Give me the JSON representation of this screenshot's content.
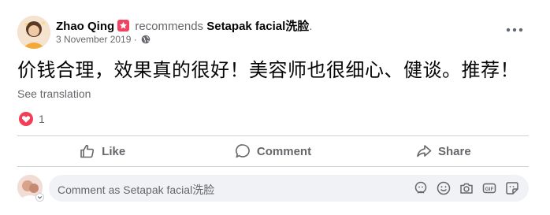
{
  "post": {
    "author": "Zhao Qing",
    "recommends_text": "recommends",
    "page_name": "Setapak facial洗脸",
    "trailing_dot": ".",
    "date": "3 November 2019",
    "date_separator": "·",
    "text": "价钱合理，效果真的很好！美容师也很细心、健谈。推荐！",
    "see_translation": "See translation",
    "reaction_count": "1"
  },
  "actions": {
    "like": "Like",
    "comment": "Comment",
    "share": "Share"
  },
  "comment_input": {
    "placeholder": "Comment as Setapak facial洗脸"
  },
  "colors": {
    "badge": "#f3425f",
    "love_reaction": "#f33e58",
    "secondary_text": "#65676b"
  },
  "icons": {
    "privacy": "globe-icon",
    "reaction": "love-reaction-icon",
    "menu": "more-options-icon",
    "comment_tools": [
      "avatar-sticker-icon",
      "emoji-icon",
      "camera-icon",
      "gif-icon",
      "sticker-icon"
    ]
  }
}
